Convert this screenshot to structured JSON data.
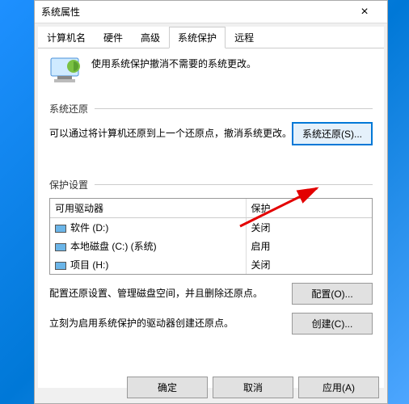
{
  "window": {
    "title": "系统属性"
  },
  "tabs": {
    "items": [
      "计算机名",
      "硬件",
      "高级",
      "系统保护",
      "远程"
    ]
  },
  "intro": "使用系统保护撤消不需要的系统更改。",
  "restore": {
    "header": "系统还原",
    "desc": "可以通过将计算机还原到上一个还原点，撤消系统更改。",
    "button": "系统还原(S)..."
  },
  "protect": {
    "header": "保护设置",
    "columns": [
      "可用驱动器",
      "保护"
    ],
    "rows": [
      {
        "name": "软件 (D:)",
        "status": "关闭"
      },
      {
        "name": "本地磁盘 (C:) (系统)",
        "status": "启用"
      },
      {
        "name": "项目 (H:)",
        "status": "关闭"
      }
    ],
    "configDesc": "配置还原设置、管理磁盘空间，并且删除还原点。",
    "configBtn": "配置(O)...",
    "createDesc": "立刻为启用系统保护的驱动器创建还原点。",
    "createBtn": "创建(C)..."
  },
  "buttons": {
    "ok": "确定",
    "cancel": "取消",
    "apply": "应用(A)"
  }
}
